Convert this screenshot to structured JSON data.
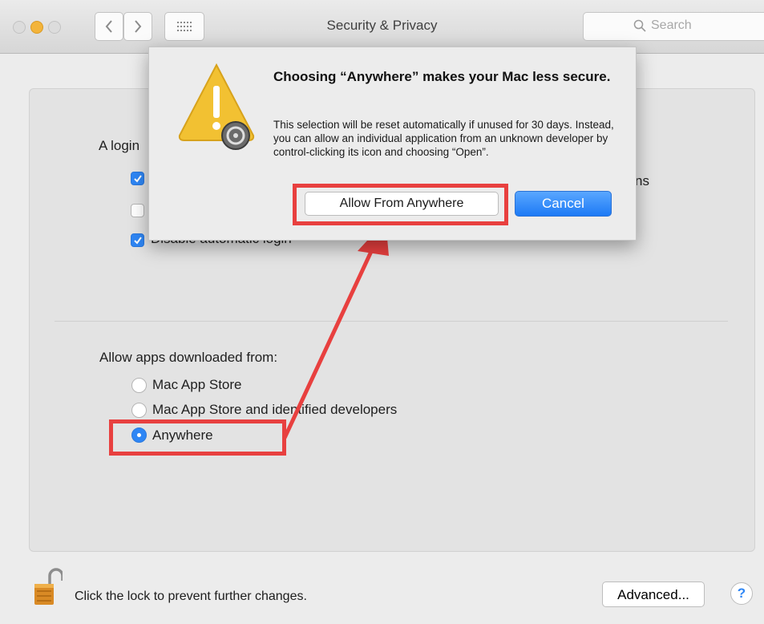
{
  "window": {
    "title": "Security & Privacy"
  },
  "search": {
    "placeholder": "Search"
  },
  "general": {
    "login_text_partial": "A login",
    "right_text_partial": "ns",
    "option3_label": "Disable automatic login"
  },
  "gatekeeper": {
    "heading": "Allow apps downloaded from:",
    "options": [
      {
        "label": "Mac App Store",
        "selected": false
      },
      {
        "label": "Mac App Store and identified developers",
        "selected": false
      },
      {
        "label": "Anywhere",
        "selected": true
      }
    ]
  },
  "dialog": {
    "title": "Choosing “Anywhere” makes your Mac less secure.",
    "body": "This selection will be reset automatically if unused for 30 days. Instead, you can allow an individual application from an unknown developer by control-clicking its icon and choosing “Open”.",
    "allow_label": "Allow From Anywhere",
    "cancel_label": "Cancel"
  },
  "footer": {
    "lock_text": "Click the lock to prevent further changes.",
    "advanced_label": "Advanced...",
    "help_label": "?"
  },
  "colors": {
    "accent": "#2e86f5",
    "highlight": "#e8403f",
    "warning": "#f2c132"
  }
}
